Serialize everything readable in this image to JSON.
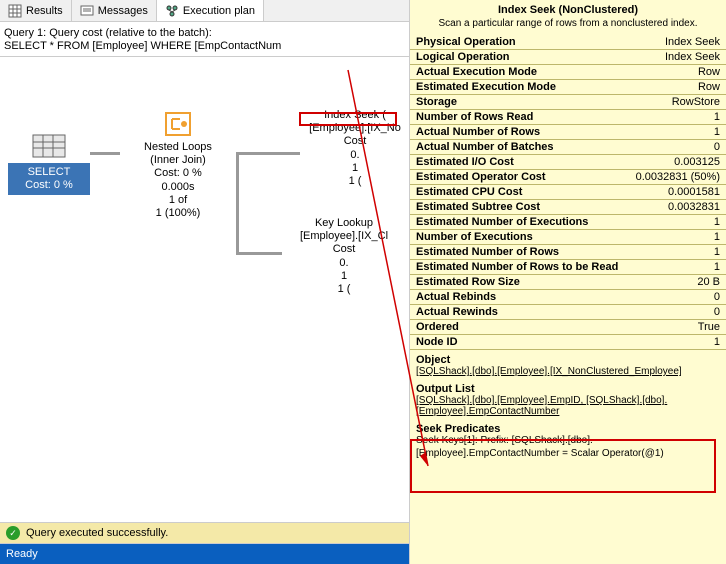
{
  "tabs": {
    "results": "Results",
    "messages": "Messages",
    "plan": "Execution plan"
  },
  "query": {
    "line1": "Query 1: Query cost (relative to the batch):",
    "line2": "SELECT * FROM [Employee] WHERE [EmpContactNum"
  },
  "nodes": {
    "select": {
      "label": "SELECT",
      "cost": "Cost: 0 %"
    },
    "nested": {
      "l1": "Nested Loops",
      "l2": "(Inner Join)",
      "l3": "Cost: 0 %",
      "l4": "0.000s",
      "l5": "1 of",
      "l6": "1 (100%)"
    },
    "seek": {
      "l1": "Index Seek (",
      "l2": "[Employee].[IX_No",
      "l3": "Cost",
      "l4": "0.",
      "l5": "1",
      "l6": "1 ("
    },
    "lookup": {
      "l1": "Key Lookup",
      "l2": "[Employee].[IX_Cl",
      "l3": "Cost",
      "l4": "0.",
      "l5": "1",
      "l6": "1 ("
    }
  },
  "tooltip": {
    "title": "Index Seek (NonClustered)",
    "desc": "Scan a particular range of rows from a nonclustered index.",
    "props": [
      {
        "k": "Physical Operation",
        "v": "Index Seek"
      },
      {
        "k": "Logical Operation",
        "v": "Index Seek"
      },
      {
        "k": "Actual Execution Mode",
        "v": "Row"
      },
      {
        "k": "Estimated Execution Mode",
        "v": "Row"
      },
      {
        "k": "Storage",
        "v": "RowStore"
      },
      {
        "k": "Number of Rows Read",
        "v": "1"
      },
      {
        "k": "Actual Number of Rows",
        "v": "1"
      },
      {
        "k": "Actual Number of Batches",
        "v": "0"
      },
      {
        "k": "Estimated I/O Cost",
        "v": "0.003125"
      },
      {
        "k": "Estimated Operator Cost",
        "v": "0.0032831 (50%)"
      },
      {
        "k": "Estimated CPU Cost",
        "v": "0.0001581"
      },
      {
        "k": "Estimated Subtree Cost",
        "v": "0.0032831"
      },
      {
        "k": "Estimated Number of Executions",
        "v": "1"
      },
      {
        "k": "Number of Executions",
        "v": "1"
      },
      {
        "k": "Estimated Number of Rows",
        "v": "1"
      },
      {
        "k": "Estimated Number of Rows to be Read",
        "v": "1"
      },
      {
        "k": "Estimated Row Size",
        "v": "20 B"
      },
      {
        "k": "Actual Rebinds",
        "v": "0"
      },
      {
        "k": "Actual Rewinds",
        "v": "0"
      },
      {
        "k": "Ordered",
        "v": "True"
      },
      {
        "k": "Node ID",
        "v": "1"
      }
    ],
    "object_head": "Object",
    "object": "[SQLShack].[dbo].[Employee].[IX_NonClustered_Employee]",
    "output_head": "Output List",
    "output": "[SQLShack].[dbo].[Employee].EmpID, [SQLShack].[dbo].[Employee].EmpContactNumber",
    "seek_head": "Seek Predicates",
    "seek_body1": "Seek Keys[1]: Prefix: [SQLShack].[dbo].",
    "seek_body2": "[Employee].EmpContactNumber = Scalar Operator(@1)"
  },
  "status": {
    "success": "Query executed successfully.",
    "ready": "Ready"
  }
}
